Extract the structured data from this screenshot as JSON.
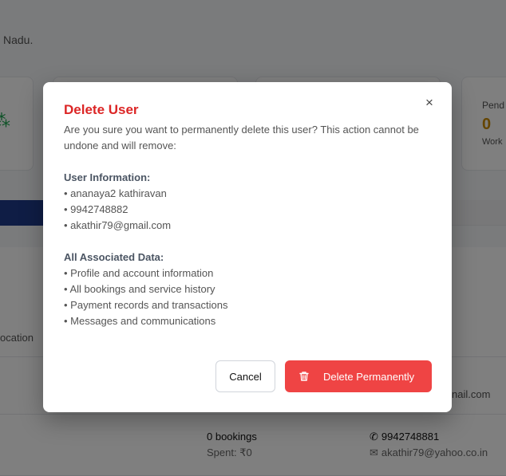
{
  "background": {
    "location_fragment": "Nadu.",
    "card_pending_label": "Pend",
    "card_pending_value": "0",
    "card_pending_sub": "Work",
    "row_location": "ocation",
    "row_email_fragment": "nail.com",
    "bookings": "0 bookings",
    "spent": "Spent: ₹0",
    "phone": "9942748881",
    "email": "akathir79@yahoo.co.in"
  },
  "modal": {
    "title": "Delete User",
    "close_symbol": "×",
    "description": "Are you sure you want to permanently delete this user? This action cannot be undone and will remove:",
    "user_info": {
      "heading": "User Information:",
      "items": [
        "ananaya2 kathiravan",
        "9942748882",
        "akathir79@gmail.com"
      ]
    },
    "associated_data": {
      "heading": "All Associated Data:",
      "items": [
        "Profile and account information",
        "All bookings and service history",
        "Payment records and transactions",
        "Messages and communications"
      ]
    },
    "cancel_label": "Cancel",
    "delete_label": "Delete Permanently"
  },
  "colors": {
    "danger": "#ef4444",
    "title": "#dc2626",
    "overlay": "rgba(0,0,0,0.5)"
  }
}
